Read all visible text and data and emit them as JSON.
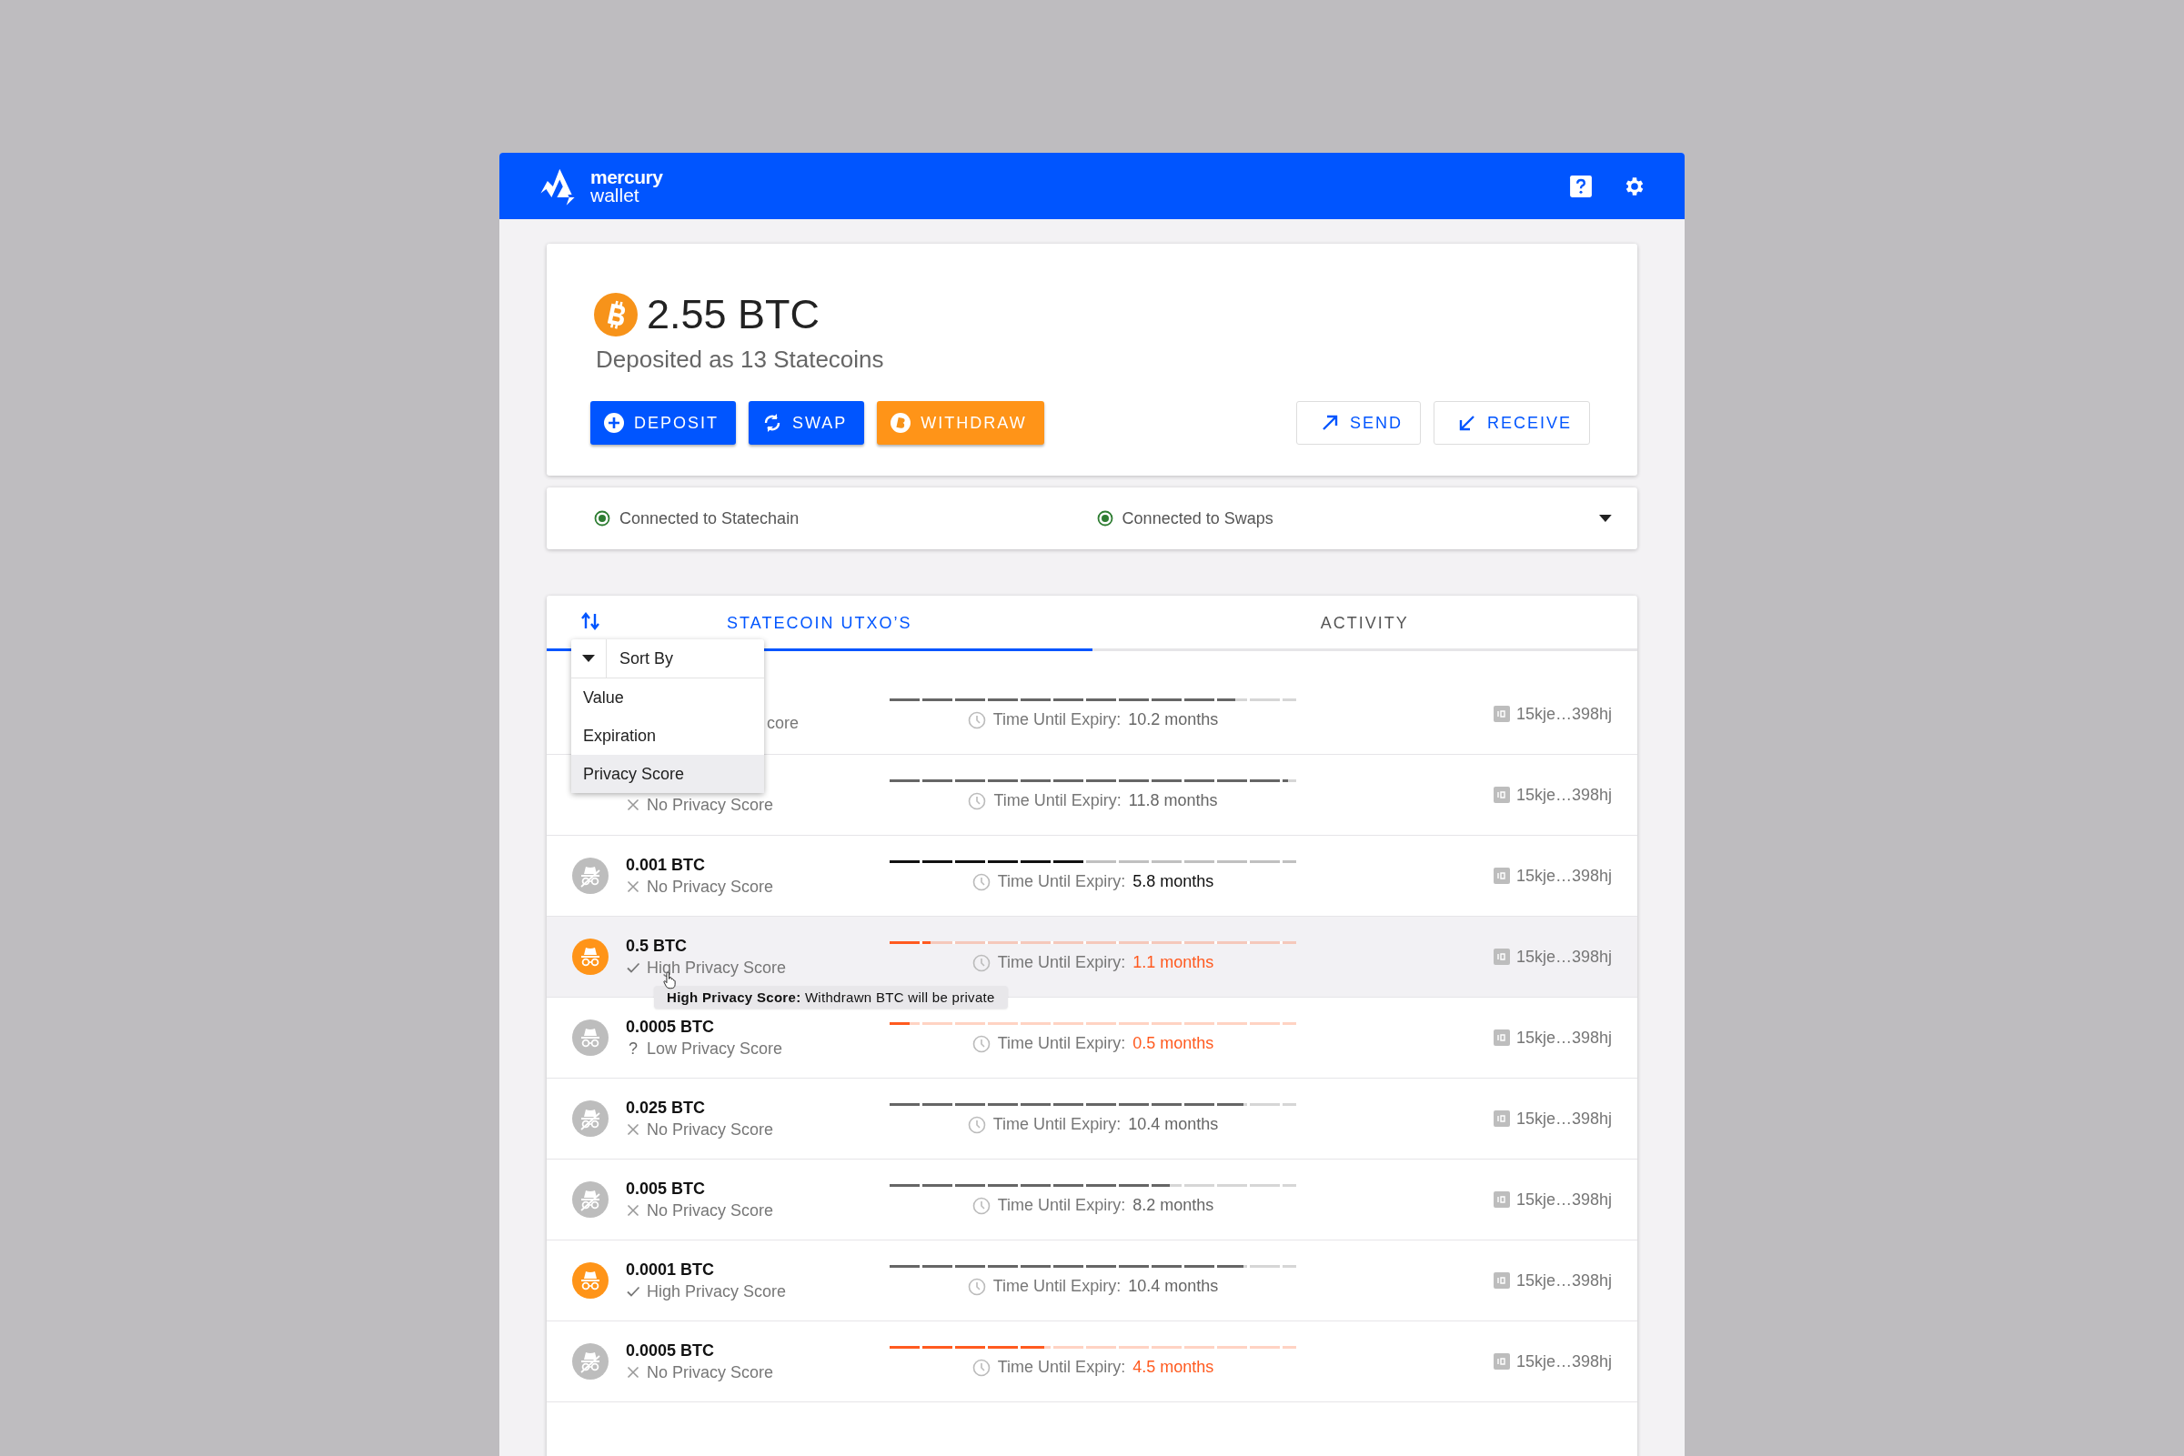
{
  "app": {
    "logo_line1": "mercury",
    "logo_line2": "wallet"
  },
  "balance": {
    "amount": "2.55 BTC",
    "subtitle": "Deposited as 13 Statecoins"
  },
  "actions": [
    {
      "label": "DEPOSIT",
      "kind": "deposit"
    },
    {
      "label": "SWAP",
      "kind": "swap"
    },
    {
      "label": "WITHDRAW",
      "kind": "withdraw"
    },
    {
      "label": "SEND",
      "kind": "send"
    },
    {
      "label": "RECEIVE",
      "kind": "receive"
    }
  ],
  "connections": [
    {
      "label": "Connected to Statechain",
      "connected": true
    },
    {
      "label": "Connected to Swaps",
      "connected": true
    }
  ],
  "tabs": [
    {
      "label": "STATECOIN UTXO’S",
      "selected": true
    },
    {
      "label": "ACTIVITY",
      "selected": false
    }
  ],
  "sort_menu": {
    "title": "Sort By",
    "options": [
      {
        "label": "Value",
        "selected": false
      },
      {
        "label": "Expiration",
        "selected": false
      },
      {
        "label": "Privacy Score",
        "selected": true
      }
    ]
  },
  "coins": [
    {
      "privacy_label": "core",
      "expiry_label": "Time Until Expiry:",
      "expiry": "10.2 months",
      "color": "#666666",
      "level": 0.85,
      "address": "15kje…398hj",
      "selected": false
    },
    {
      "kind": "none",
      "privacy_label": "No Privacy Score",
      "expiry_label": "Time Until Expiry:",
      "expiry": "11.8 months",
      "color": "#666666",
      "level": 0.98,
      "address": "15kje…398hj",
      "selected": false
    },
    {
      "amount": "0.001 BTC",
      "kind": "none",
      "privacy_label": "No Privacy Score",
      "expiry_label": "Time Until Expiry:",
      "expiry": "5.8 months",
      "color": "#111111",
      "level": 0.48,
      "address": "15kje…398hj",
      "selected": false
    },
    {
      "amount": "0.5 BTC",
      "kind": "high",
      "privacy_label": "High Privacy Score",
      "expiry_label": "Time Until Expiry:",
      "expiry": "1.1 months",
      "color": "#ff5a1f",
      "level": 0.1,
      "address": "15kje…398hj",
      "selected": true,
      "tooltip": "**High Privacy Score:** Withdrawn BTC will be private"
    },
    {
      "amount": "0.0005 BTC",
      "kind": "low",
      "mark": "?",
      "privacy_label": "Low Privacy Score",
      "expiry_label": "Time Until Expiry:",
      "expiry": "0.5 months",
      "color": "#ff5a1f",
      "level": 0.05,
      "address": "15kje…398hj",
      "selected": false
    },
    {
      "amount": "0.025 BTC",
      "kind": "none",
      "privacy_label": "No Privacy Score",
      "expiry_label": "Time Until Expiry:",
      "expiry": "10.4 months",
      "color": "#666666",
      "level": 0.87,
      "address": "15kje…398hj",
      "selected": false
    },
    {
      "amount": "0.005 BTC",
      "kind": "none",
      "privacy_label": "No Privacy Score",
      "expiry_label": "Time Until Expiry:",
      "expiry": "8.2 months",
      "color": "#666666",
      "level": 0.69,
      "address": "15kje…398hj",
      "selected": false
    },
    {
      "amount": "0.0001 BTC",
      "kind": "high",
      "privacy_label": "High Privacy Score",
      "expiry_label": "Time Until Expiry:",
      "expiry": "10.4 months",
      "color": "#666666",
      "level": 0.87,
      "address": "15kje…398hj",
      "selected": false
    },
    {
      "amount": "0.0005 BTC",
      "kind": "none",
      "privacy_label": "No Privacy Score",
      "expiry_label": "Time Until Expiry:",
      "expiry": "4.5 months",
      "color": "#ff5a1f",
      "level": 0.38,
      "address": "15kje…398hj",
      "selected": false
    }
  ]
}
